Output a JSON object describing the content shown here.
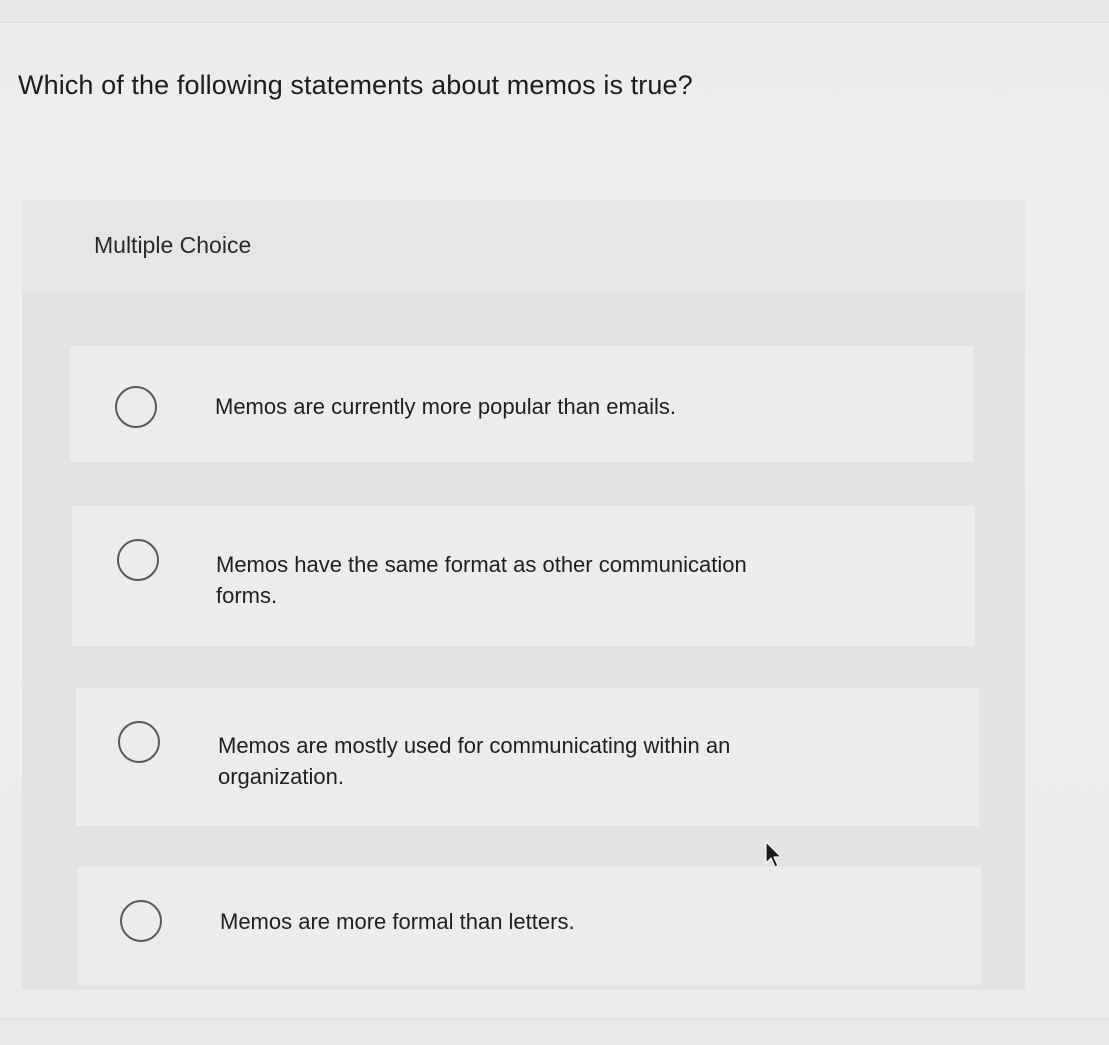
{
  "question": {
    "text": "Which of the following statements about memos is true?"
  },
  "multiple_choice": {
    "label": "Multiple Choice",
    "options": [
      {
        "text": "Memos are currently more popular than emails.",
        "selected": false
      },
      {
        "text": "Memos have the same format as other communication forms.",
        "selected": false
      },
      {
        "text": "Memos are mostly used for communicating within an organization.",
        "selected": false
      },
      {
        "text": "Memos are more formal than letters.",
        "selected": false
      }
    ]
  },
  "icons": {
    "radio": "radio-unselected-icon",
    "cursor": "mouse-pointer-icon"
  },
  "colors": {
    "background": "#ececec",
    "panel": "#e2e2e2",
    "radio_border": "#5a5a5c",
    "text": "#1d1d1f"
  }
}
